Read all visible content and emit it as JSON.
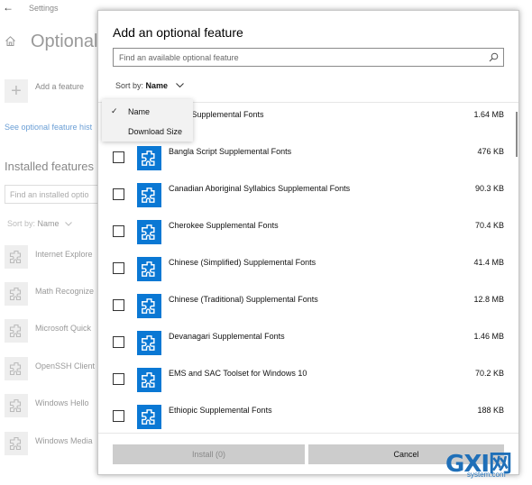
{
  "background_window": {
    "title": "Settings",
    "back_glyph": "←",
    "heading": "Optional",
    "add_glyph": "+",
    "add_feature_label": "Add a feature",
    "history_link": "See optional feature hist",
    "installed_heading": "Installed features",
    "find_placeholder": "Find an installed optio",
    "sort_prefix": "Sort by:",
    "sort_value": "Name",
    "installed_items": [
      {
        "label": "Internet Explore"
      },
      {
        "label": "Math Recognize"
      },
      {
        "label": "Microsoft Quick"
      },
      {
        "label": "OpenSSH Client"
      },
      {
        "label": "Windows Hello"
      },
      {
        "label": "Windows Media"
      }
    ]
  },
  "dialog": {
    "title": "Add an optional feature",
    "search_placeholder": "Find an available optional feature",
    "sort_prefix": "Sort by:",
    "sort_value": "Name",
    "features": [
      {
        "name": "Script Supplemental Fonts",
        "size": "1.64 MB",
        "checked": false
      },
      {
        "name": "Bangla Script Supplemental Fonts",
        "size": "476 KB",
        "checked": false
      },
      {
        "name": "Canadian Aboriginal Syllabics Supplemental Fonts",
        "size": "90.3 KB",
        "checked": false
      },
      {
        "name": "Cherokee Supplemental Fonts",
        "size": "70.4 KB",
        "checked": false
      },
      {
        "name": "Chinese (Simplified) Supplemental Fonts",
        "size": "41.4 MB",
        "checked": false
      },
      {
        "name": "Chinese (Traditional) Supplemental Fonts",
        "size": "12.8 MB",
        "checked": false
      },
      {
        "name": "Devanagari Supplemental Fonts",
        "size": "1.46 MB",
        "checked": false
      },
      {
        "name": "EMS and SAC Toolset for Windows 10",
        "size": "70.2 KB",
        "checked": false
      },
      {
        "name": "Ethiopic Supplemental Fonts",
        "size": "188 KB",
        "checked": false
      }
    ],
    "install_button": "Install (0)",
    "cancel_button": "Cancel"
  },
  "sort_menu": {
    "items": [
      {
        "label": "Name",
        "selected": true,
        "check_glyph": "✓"
      },
      {
        "label": "Download Size",
        "selected": false,
        "check_glyph": ""
      }
    ]
  },
  "watermark": {
    "top": "GXI网",
    "bottom": "system.com"
  },
  "colors": {
    "accent": "#0a78d4",
    "link": "#6a9ed5",
    "button_bg": "#cccccc",
    "menu_bg": "#f2f2f2"
  },
  "icons": {
    "feature": "puzzle-piece-icon",
    "search": "search-icon",
    "home": "home-icon",
    "chevron": "chevron-down-icon"
  }
}
